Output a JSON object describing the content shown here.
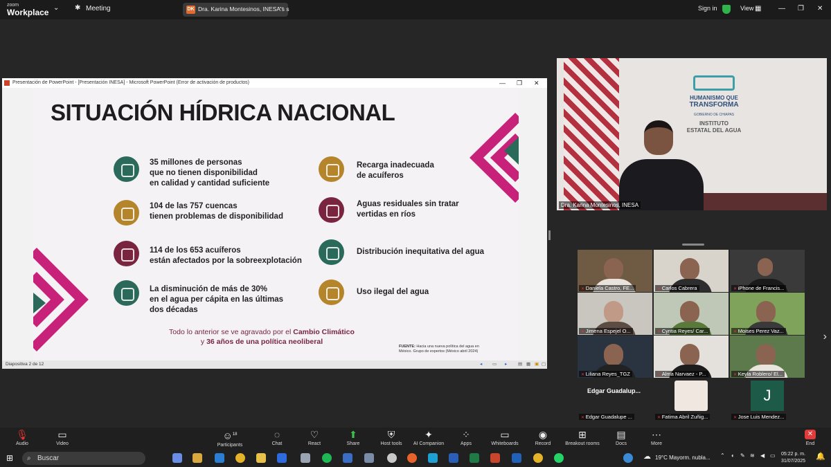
{
  "topbar": {
    "logo_small": "zoom",
    "logo_big": "Workplace",
    "meeting_tab": "Meeting",
    "active_tab_initials": "DK",
    "active_tab": "Dra. Karina Montesinos, INESA's s",
    "sign_in": "Sign in",
    "view": "View"
  },
  "ppt": {
    "window_title": "Presentación de PowerPoint - [Presentación INESA] - Microsoft PowerPoint (Error de activación de productos)",
    "status": "Diapositiva 2 de 12",
    "slide": {
      "title": "SITUACIÓN HÍDRICA NACIONAL",
      "items_left": [
        {
          "text": "35 millones de personas\nque no tienen disponibilidad\nen calidad y cantidad suficiente",
          "color": "#2b6a5a"
        },
        {
          "text": "104 de las 757 cuencas\ntienen problemas de disponibilidad",
          "color": "#b5852c"
        },
        {
          "text": "114 de los 653 acuíferos\nestán afectados por la sobreexplotación",
          "color": "#7a2540"
        },
        {
          "text": "La disminución de más de 30%\nen el agua per cápita en las últimas\ndos décadas",
          "color": "#2b6a5a"
        }
      ],
      "items_right": [
        {
          "text": "Recarga inadecuada\nde acuíferos",
          "color": "#b5852c"
        },
        {
          "text": "Aguas residuales sin tratar\nvertidas en ríos",
          "color": "#7a2540"
        },
        {
          "text": "Distribución inequitativa del agua",
          "color": "#2b6a5a"
        },
        {
          "text": "Uso ilegal del agua",
          "color": "#b5852c"
        }
      ],
      "note_pre": "Todo lo anterior se ve agravado por el ",
      "note_bold1": "Cambio Climático",
      "note_mid": "y ",
      "note_bold2": "36 años de una política neoliberal",
      "source_label": "FUENTE:",
      "source_text": "Hacia una nueva política del agua en México. Grupo de expertos (México abril 2024)"
    }
  },
  "speaker": {
    "name": "Dra. Karina Montesinos, INESA",
    "logo_line1": "HUMANISMO QUE",
    "logo_line2": "TRANSFORMA",
    "logo_line3": "GOBIERNO DE CHIAPAS",
    "logo_line4": "INSTITUTO",
    "logo_line5": "ESTATAL DEL AGUA"
  },
  "participants": [
    {
      "name": "Daniela Castro, FE..."
    },
    {
      "name": "Carlos Cabrera"
    },
    {
      "name": "iPhone de Francis..."
    },
    {
      "name": "Jimena Espejel O..."
    },
    {
      "name": "Cyntia Reyes/ Car..."
    },
    {
      "name": "Moises Perez Vaz..."
    },
    {
      "name": "Liliana Reyes_TGZ"
    },
    {
      "name": "Alma Narvaez - P..."
    },
    {
      "name": "Keyla Roblero/ El..."
    },
    {
      "name": "Edgar Guadalupe ...",
      "big": "Edgar  Guadalup..."
    },
    {
      "name": "Fatima Abril Zuñig..."
    },
    {
      "name": "Jose Luis Mendez...",
      "initial": "J"
    }
  ],
  "toolbar": {
    "audio": "Audio",
    "video": "Video",
    "participants": "Participants",
    "participants_count": "18",
    "chat": "Chat",
    "react": "React",
    "share": "Share",
    "host_tools": "Host tools",
    "ai_companion": "AI Companion",
    "apps": "Apps",
    "whiteboards": "Whiteboards",
    "record": "Record",
    "breakout_rooms": "Breakout rooms",
    "docs": "Docs",
    "more": "More",
    "end": "End"
  },
  "taskbar": {
    "search_placeholder": "Buscar",
    "weather": "19°C  Mayorm. nubla...",
    "time": "05:22 p. m.",
    "date": "31/07/2025"
  }
}
